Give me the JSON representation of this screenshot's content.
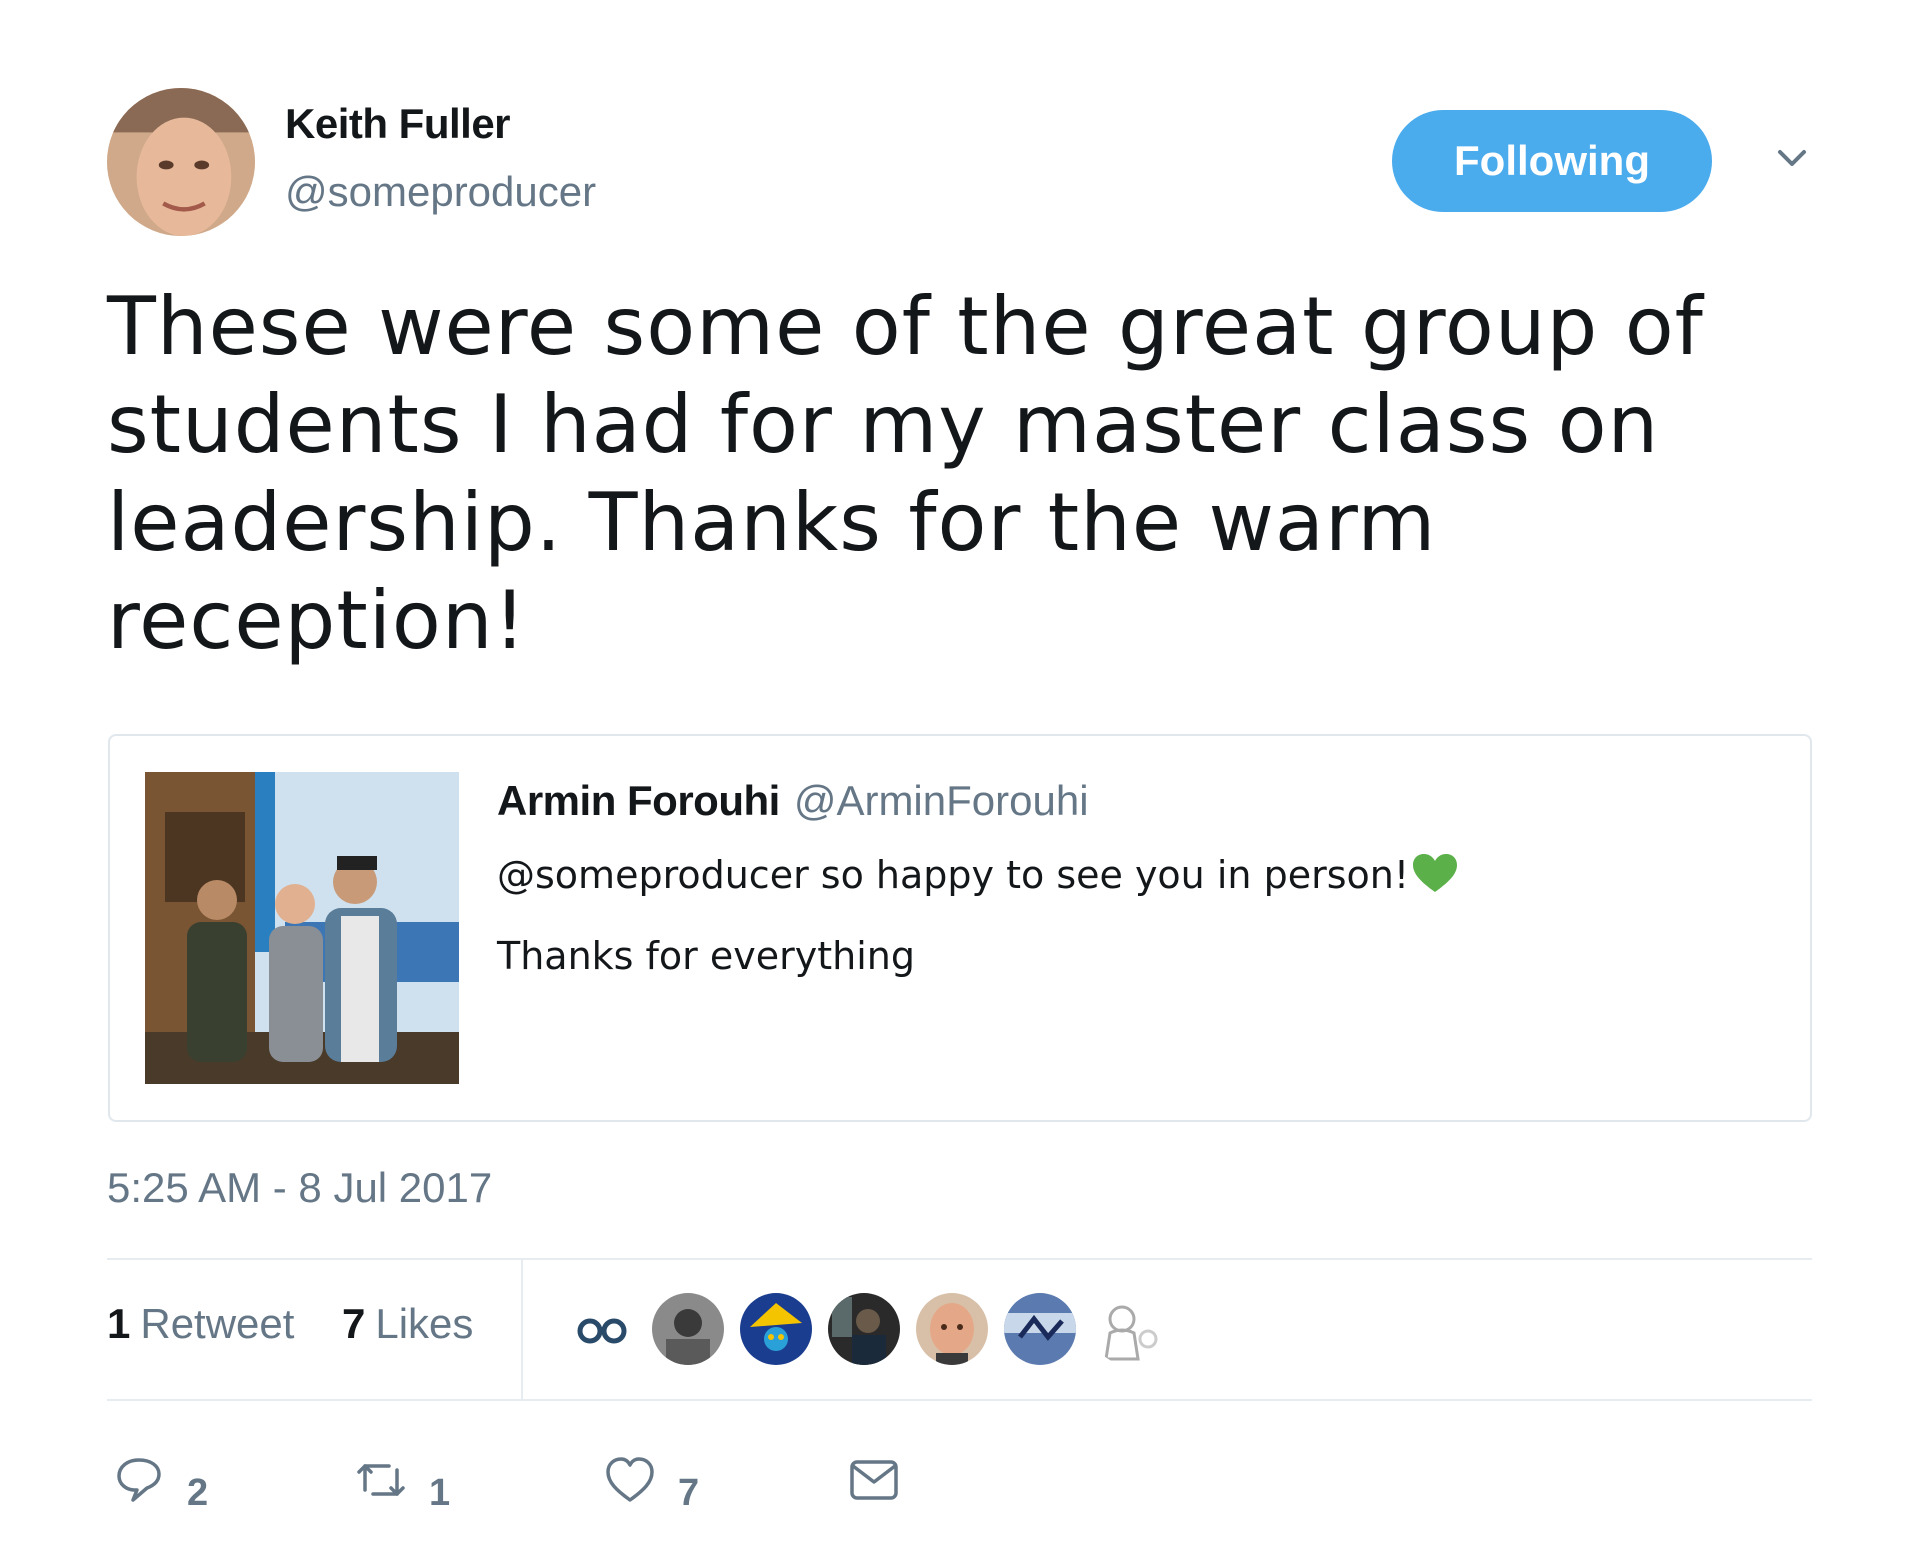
{
  "author": {
    "name": "Keith Fuller",
    "handle": "@someproducer",
    "follow_label": "Following"
  },
  "tweet": {
    "lines": [
      "These were some of the great group of",
      "students I had for my master class on",
      "leadership. Thanks for the warm",
      "reception!"
    ],
    "timestamp": "5:25 AM - 8 Jul 2017"
  },
  "quoted": {
    "name": "Armin Forouhi",
    "handle": "@ArminForouhi",
    "line1": "@someproducer so happy to see you in person!",
    "line2": "Thanks for everything"
  },
  "stats": {
    "retweets_count": "1",
    "retweets_label": "Retweet",
    "likes_count": "7",
    "likes_label": "Likes"
  },
  "actions": {
    "replies": "2",
    "retweets": "1",
    "likes": "7"
  },
  "colors": {
    "accent": "#4aabed",
    "muted": "#657786",
    "text": "#14171a",
    "heart_green": "#5bb04a"
  }
}
